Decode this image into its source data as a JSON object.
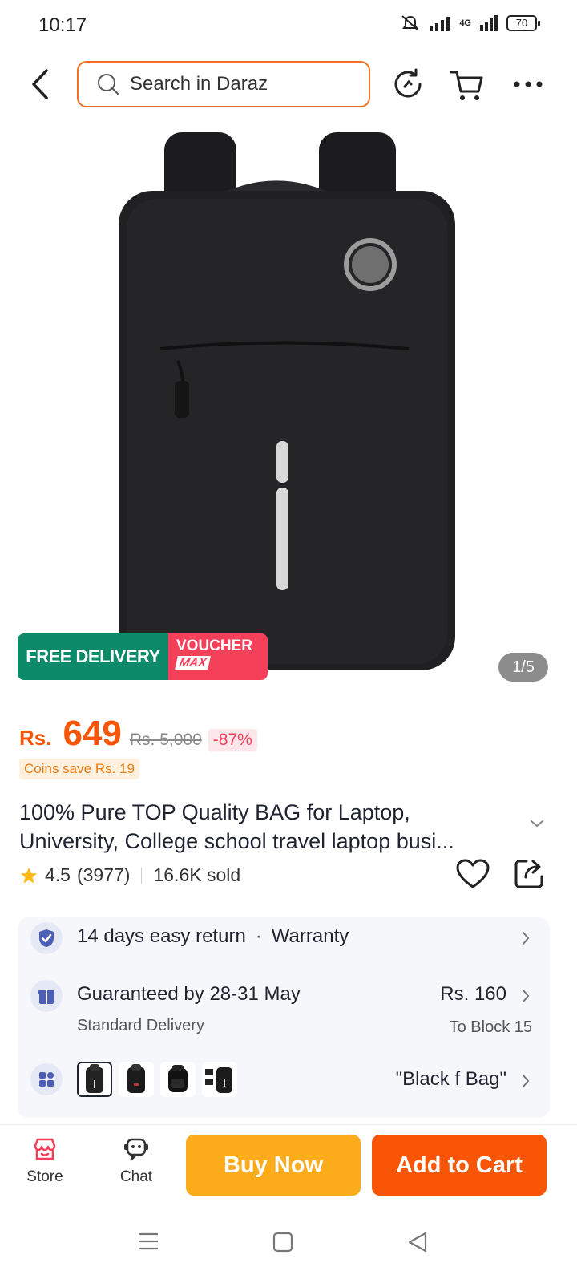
{
  "status_bar": {
    "time": "10:17",
    "network": "4G",
    "battery": "70"
  },
  "header": {
    "search_placeholder": "Search in Daraz",
    "icons": [
      "back-icon",
      "search-icon",
      "history-icon",
      "cart-icon",
      "more-icon"
    ]
  },
  "product": {
    "image_alt": "Black laptop backpack",
    "badge": {
      "free_delivery": "FREE DELIVERY",
      "voucher": "VOUCHER",
      "max": "MAX"
    },
    "image_counter": "1/5",
    "price": {
      "currency": "Rs.",
      "amount": "649",
      "original": "Rs. 5,000",
      "discount": "-87%"
    },
    "coins": "Coins save Rs. 19",
    "title_line1": "100% Pure TOP Quality BAG for Laptop,",
    "title_line2": "University,  College school travel laptop busi...",
    "rating": "4.5",
    "reviews": "(3977)",
    "sold": "16.6K sold"
  },
  "info": {
    "return": "14 days easy return",
    "warranty": "Warranty",
    "delivery_title": "Guaranteed by 28-31 May",
    "delivery_type": "Standard Delivery",
    "delivery_price": "Rs. 160",
    "delivery_to": "To Block 15",
    "variant": "\"Black f Bag\""
  },
  "bottom_bar": {
    "store": "Store",
    "chat": "Chat",
    "buy_now": "Buy Now",
    "add_to_cart": "Add to Cart"
  },
  "colors": {
    "accent": "#f85606",
    "buy": "#fcac1b",
    "free_delivery": "#0d8a6a",
    "voucher": "#f5405a"
  }
}
